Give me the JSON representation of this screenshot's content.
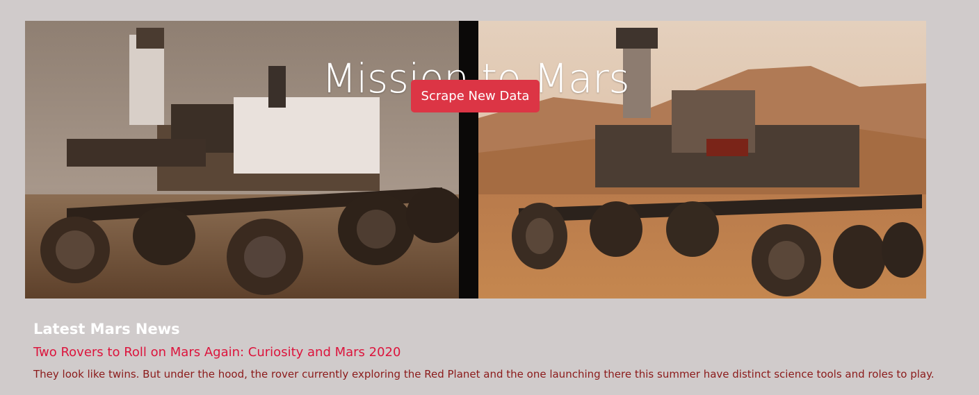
{
  "hero": {
    "title": "Mission to Mars",
    "button_label": "Scrape New Data"
  },
  "news": {
    "heading": "Latest Mars News",
    "title": "Two Rovers to Roll on Mars Again: Curiosity and Mars 2020",
    "teaser": "They look like twins. But under the hood, the rover currently exploring the Red Planet and the one launching there this summer have distinct science tools and roles to play."
  },
  "colors": {
    "page_background": "#d0cbcb",
    "button": "#dc3545",
    "news_title": "#dc143c",
    "news_teaser": "#8b1a1a"
  }
}
